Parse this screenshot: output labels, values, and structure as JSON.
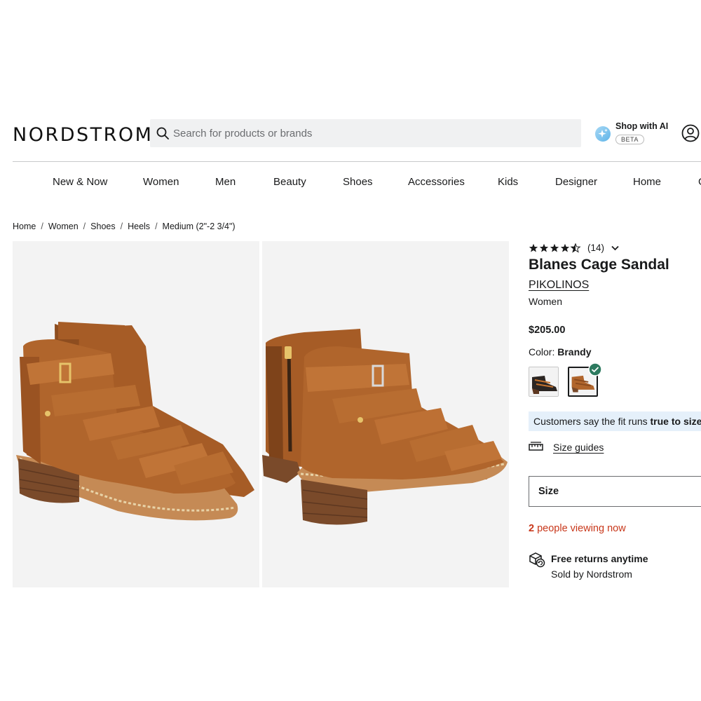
{
  "header": {
    "logo": "NORDSTROM",
    "search_placeholder": "Search for products or brands",
    "ai_label": "Shop with AI",
    "ai_badge": "BETA"
  },
  "nav": [
    "New & Now",
    "Women",
    "Men",
    "Beauty",
    "Shoes",
    "Accessories",
    "Kids",
    "Designer",
    "Home",
    "G"
  ],
  "breadcrumb": [
    "Home",
    "Women",
    "Shoes",
    "Heels",
    "Medium (2\"-2 3/4\")"
  ],
  "product": {
    "rating_stars": 4.5,
    "rating_count": "(14)",
    "title": "Blanes Cage Sandal",
    "brand": "PIKOLINOS",
    "gender": "Women",
    "price": "$205.00",
    "color_label": "Color:",
    "color_value": "Brandy",
    "swatches": [
      {
        "name": "Black multi",
        "selected": false,
        "color": "#2b2522"
      },
      {
        "name": "Brandy",
        "selected": true,
        "color": "#b0652c"
      }
    ],
    "fit_prefix": "Customers say the fit runs",
    "fit_value": "true to size.",
    "size_guides": "Size guides",
    "size_label": "Size",
    "viewing_count": "2",
    "viewing_text": "people viewing now",
    "returns_title": "Free returns anytime",
    "returns_sub": "Sold by Nordstrom"
  },
  "colors": {
    "leather": "#b0652c",
    "alert": "#c8371a",
    "fit_bg": "#e5f0fa",
    "check": "#2d7a5f"
  }
}
